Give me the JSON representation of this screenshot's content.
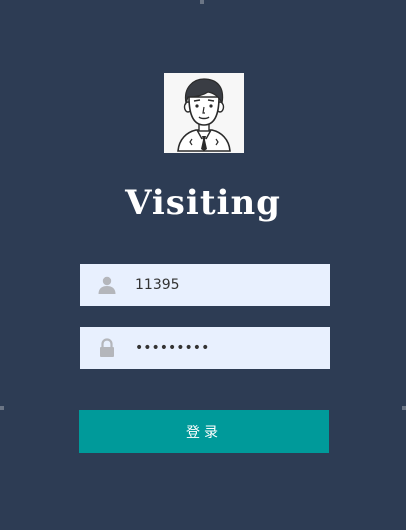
{
  "app": {
    "title": "Visiting",
    "avatar_icon": "man-avatar-icon"
  },
  "form": {
    "username": {
      "value": "11395",
      "icon": "user-icon"
    },
    "password": {
      "value": "123456789",
      "icon": "lock-icon"
    },
    "login_label": "登录"
  },
  "colors": {
    "background": "#2d3c54",
    "input_background": "#e8f0fe",
    "button": "#009a9a",
    "icon_gray": "#b4b6bb"
  }
}
